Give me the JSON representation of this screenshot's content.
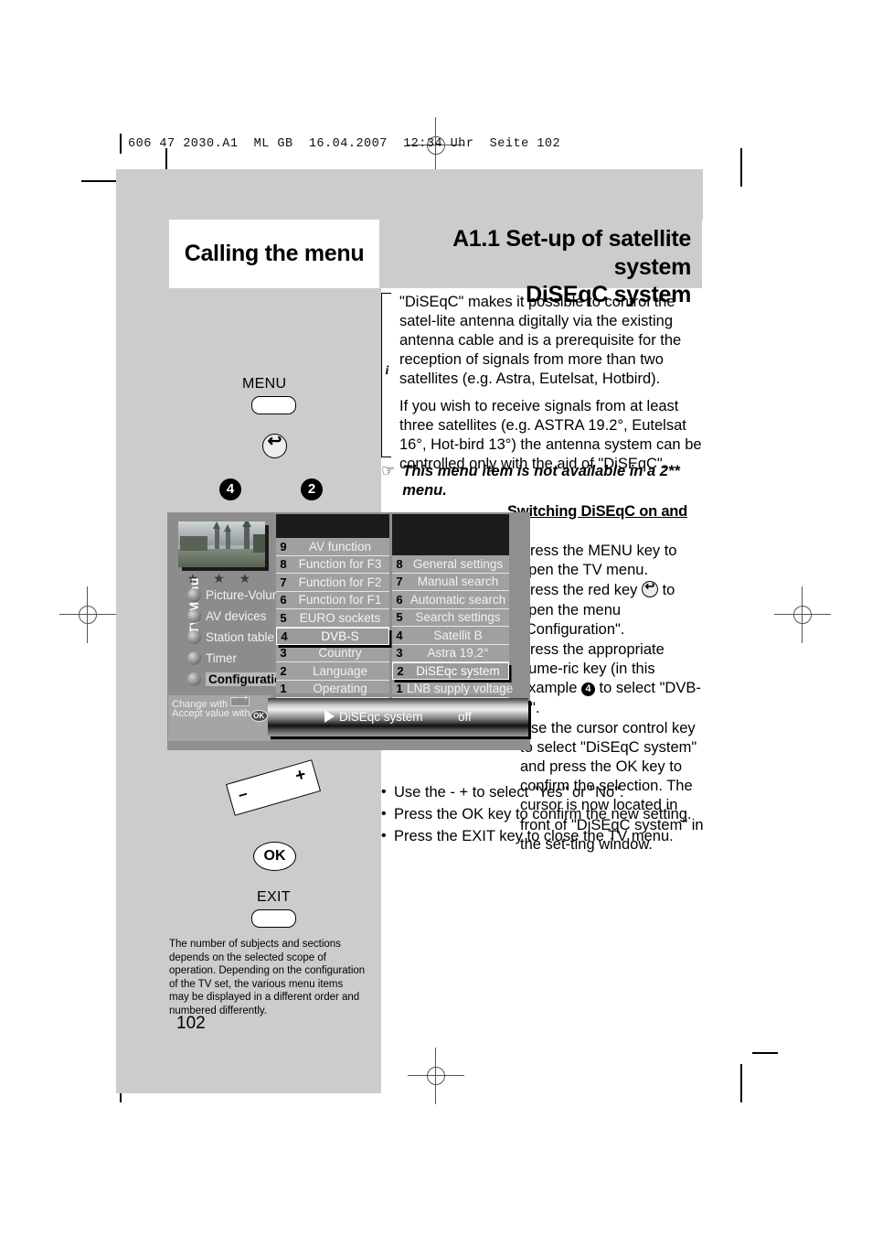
{
  "page_header": "606 47 2030.A1  ML GB  16.04.2007  12:34 Uhr  Seite 102",
  "titles": {
    "left": "Calling the menu",
    "right_line1": "A1.1 Set-up of satellite system",
    "right_line2": "DiSEqC system"
  },
  "info": {
    "icon": "i",
    "paragraph1": "\"DiSEqC\" makes it possible to control the satel-lite antenna digitally via the existing antenna cable and is a prerequisite for the reception of signals from more than two satellites (e.g. Astra, Eutelsat, Hotbird).",
    "paragraph2": "If you wish to receive signals from at least three satellites (e.g. ASTRA 19.2°, Eutelsat 16°, Hot-bird 13°) the antenna system can be controlled only with the aid of \"DiSEqC\"."
  },
  "note": {
    "icon": "pointing-hand-icon",
    "glyph": "☞",
    "text": "This menu item is not available in a 2** menu."
  },
  "procedure": {
    "heading": "Switching DiSEqC on and off",
    "steps": [
      "Press the MENU key to open the TV menu.",
      "Press the red key  to open the menu \"Configuration\".",
      "Press the appropriate nume-ric key (in this example  to select \"DVB-S\".",
      "Use the cursor control key to select \"DiSEqC system\" and press the OK key to confirm the selection. The cursor is now located in front of \"DiSEqC system\" in the set-ting window."
    ],
    "steps2": [
      "Use the - + to select \"Yes\" or \"No\".",
      "Press the OK key to confirm the new setting.",
      "Press the EXIT key to close the TV menu."
    ],
    "numeric_key_example": "4"
  },
  "remote": {
    "menu_label": "MENU",
    "red_key_icon": "return-arrow-icon",
    "red_key_glyph": "↩",
    "numeric_key_4": "4",
    "numeric_key_2": "2",
    "rocker_minus": "−",
    "rocker_plus": "+",
    "ok_label": "OK",
    "exit_label": "EXIT"
  },
  "tv_menu": {
    "vertical_label": "TV-Menu",
    "stars": "★ ★ ★",
    "main_items": [
      {
        "label": "Picture-Volume",
        "selected": false
      },
      {
        "label": "AV devices",
        "selected": false
      },
      {
        "label": "Station table",
        "selected": false
      },
      {
        "label": "Timer",
        "selected": false
      },
      {
        "label": "Configuration",
        "selected": true
      }
    ],
    "hint": {
      "line1": "Change with",
      "line2": "Accept value with",
      "ok_glyph": "OK"
    },
    "column2": [
      {
        "num": "9",
        "label": "AV function",
        "selected": false
      },
      {
        "num": "8",
        "label": "Function for F3",
        "selected": false
      },
      {
        "num": "7",
        "label": "Function for F2",
        "selected": false
      },
      {
        "num": "6",
        "label": "Function for F1",
        "selected": false
      },
      {
        "num": "5",
        "label": "EURO sockets",
        "selected": false
      },
      {
        "num": "4",
        "label": "DVB-S",
        "selected": true
      },
      {
        "num": "3",
        "label": "Country",
        "selected": false
      },
      {
        "num": "2",
        "label": "Language",
        "selected": false
      },
      {
        "num": "1",
        "label": "Operating",
        "selected": false
      }
    ],
    "column3": [
      {
        "num": "8",
        "label": "General settings",
        "selected": false
      },
      {
        "num": "7",
        "label": "Manual search",
        "selected": false
      },
      {
        "num": "6",
        "label": "Automatic search",
        "selected": false
      },
      {
        "num": "5",
        "label": "Search settings",
        "selected": false
      },
      {
        "num": "4",
        "label": "Satellit B",
        "selected": false
      },
      {
        "num": "3",
        "label": "Astra 19,2°",
        "selected": false
      },
      {
        "num": "2",
        "label": "DiSEqc system",
        "selected": true
      },
      {
        "num": "1",
        "label": "LNB supply voltage",
        "selected": false
      }
    ],
    "status_bar": {
      "label": "DiSEqc system",
      "value": "off",
      "cursor": "▶"
    }
  },
  "footnote": "The number of subjects and sections depends on the selected scope of operation. Depending on the configuration of the TV set, the various menu items may be displayed in a different order and numbered differently.",
  "page_number": "102"
}
